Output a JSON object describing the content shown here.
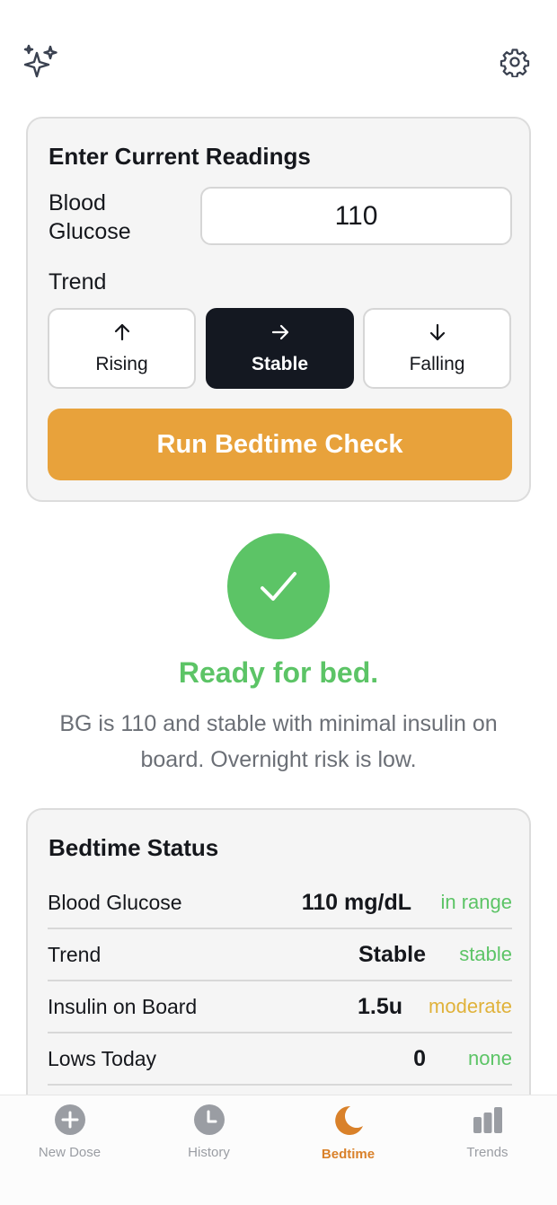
{
  "readings": {
    "title": "Enter Current Readings",
    "bg_label": "Blood Glucose",
    "bg_value": "110",
    "trend_label": "Trend",
    "trend_options": [
      {
        "label": "Rising",
        "icon": "arrow-up-icon"
      },
      {
        "label": "Stable",
        "icon": "arrow-right-icon",
        "selected": true
      },
      {
        "label": "Falling",
        "icon": "arrow-down-icon"
      }
    ],
    "run_label": "Run Bedtime Check"
  },
  "result": {
    "title": "Ready for bed.",
    "description": "BG is 110 and stable with minimal insulin on board. Overnight risk is low.",
    "color": "#5cc466"
  },
  "status": {
    "title": "Bedtime Status",
    "rows": [
      {
        "label": "Blood Glucose",
        "value": "110 mg/dL",
        "badge": "in range",
        "badge_color": "#5cc466"
      },
      {
        "label": "Trend",
        "value": "Stable",
        "badge": "stable",
        "badge_color": "#5cc466"
      },
      {
        "label": "Insulin on Board",
        "value": "1.5u",
        "badge": "moderate",
        "badge_color": "#e0b23a"
      },
      {
        "label": "Lows Today",
        "value": "0",
        "badge": "none",
        "badge_color": "#5cc466"
      }
    ]
  },
  "tabs": [
    {
      "label": "New Dose",
      "icon": "plus-circle-icon"
    },
    {
      "label": "History",
      "icon": "clock-icon"
    },
    {
      "label": "Bedtime",
      "icon": "moon-icon",
      "active": true
    },
    {
      "label": "Trends",
      "icon": "bar-chart-icon"
    }
  ],
  "colors": {
    "accent": "#e8a23b",
    "selected": "#141821",
    "active_tab": "#d9812a"
  }
}
